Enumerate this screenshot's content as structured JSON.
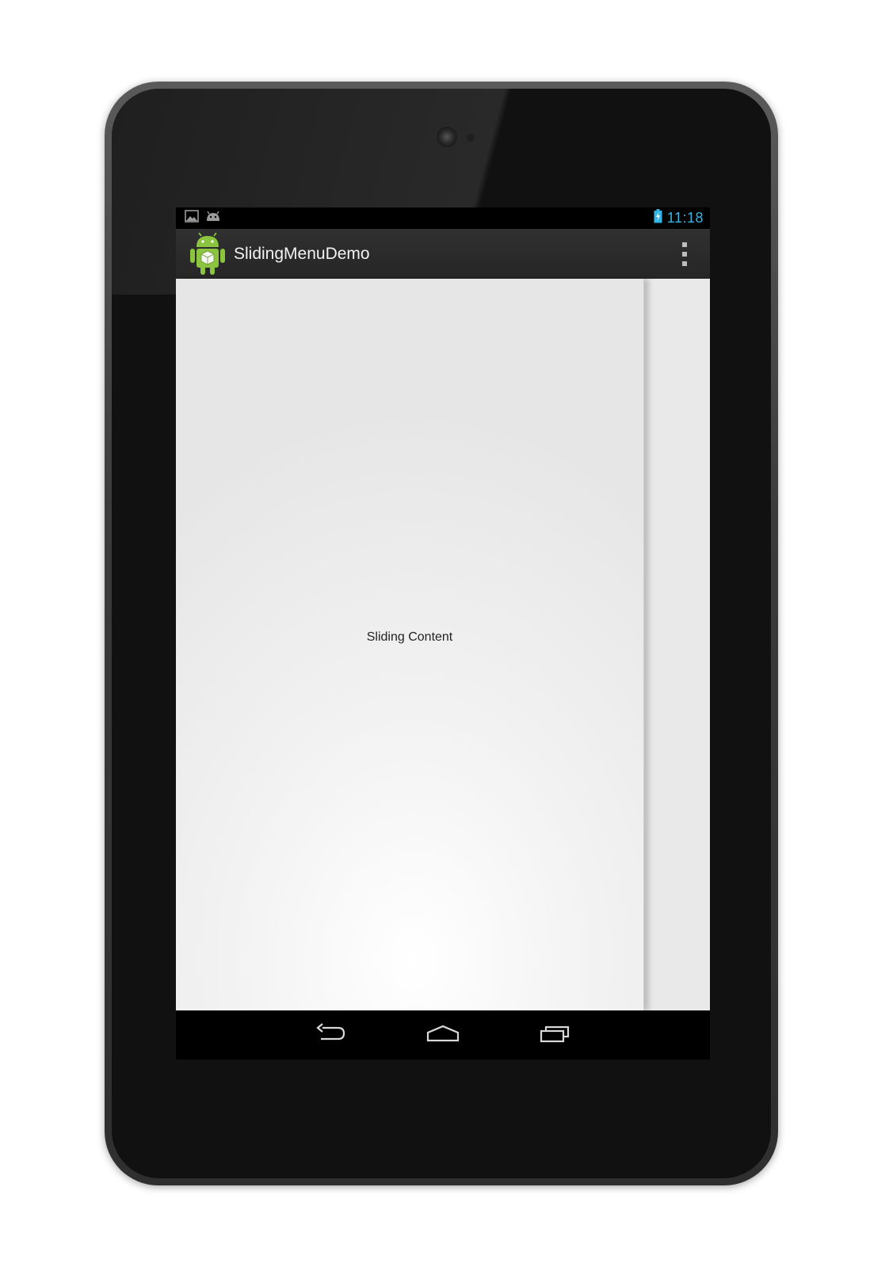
{
  "status_bar": {
    "time": "11:18",
    "icons": [
      "image-notification-icon",
      "android-notification-icon",
      "battery-charging-icon"
    ]
  },
  "action_bar": {
    "title": "SlidingMenuDemo",
    "app_icon": "android-app-icon",
    "overflow_icon": "overflow-menu-icon"
  },
  "content": {
    "sliding_text": "Sliding Content"
  },
  "nav_bar": {
    "buttons": [
      "back-icon",
      "home-icon",
      "recent-apps-icon"
    ]
  },
  "colors": {
    "status_time": "#33b5e5",
    "action_bar": "#2b2b2b",
    "content_bg": "#ebebeb",
    "android_green": "#8bc53f"
  }
}
